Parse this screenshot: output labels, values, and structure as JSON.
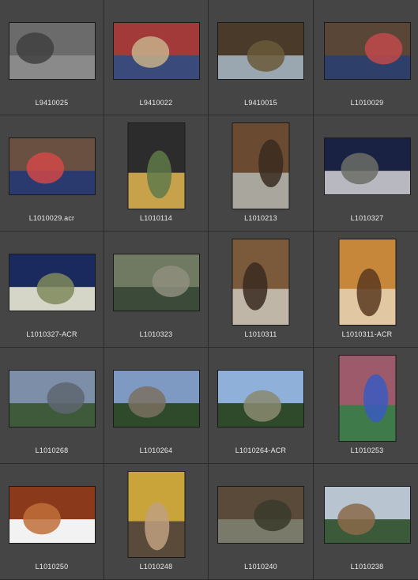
{
  "thumbnails": [
    {
      "label": "L9410025",
      "orientation": "land",
      "colors": [
        "#6b6b6b",
        "#8a8a8a",
        "#3f3f3f"
      ]
    },
    {
      "label": "L9410022",
      "orientation": "land",
      "colors": [
        "#a33a3a",
        "#3a4a7a",
        "#c7b08a"
      ]
    },
    {
      "label": "L9410015",
      "orientation": "land",
      "colors": [
        "#4a3a2a",
        "#9aa6b0",
        "#6a5a3a"
      ]
    },
    {
      "label": "L1010029",
      "orientation": "land",
      "colors": [
        "#5a4636",
        "#2e3f6a",
        "#c04a4a"
      ]
    },
    {
      "label": "L1010029.acr",
      "orientation": "land",
      "colors": [
        "#6a5040",
        "#2a3a6e",
        "#d04848"
      ]
    },
    {
      "label": "L1010114",
      "orientation": "port",
      "colors": [
        "#2c2c2c",
        "#c7a24a",
        "#5f7a4a"
      ]
    },
    {
      "label": "L1010213",
      "orientation": "port",
      "colors": [
        "#6a4a30",
        "#a9a69e",
        "#3a2a20"
      ]
    },
    {
      "label": "L1010327",
      "orientation": "land",
      "colors": [
        "#1a2244",
        "#b8b8c0",
        "#6b6f66"
      ]
    },
    {
      "label": "L1010327-ACR",
      "orientation": "land",
      "colors": [
        "#1b2a5e",
        "#d6d6c8",
        "#7f8a5a"
      ]
    },
    {
      "label": "L1010323",
      "orientation": "land",
      "colors": [
        "#707a62",
        "#3c4a3a",
        "#8e8e7e"
      ]
    },
    {
      "label": "L1010311",
      "orientation": "port",
      "colors": [
        "#7a5a3a",
        "#c0b6a8",
        "#3a2a20"
      ]
    },
    {
      "label": "L1010311-ACR",
      "orientation": "port",
      "colors": [
        "#c7873a",
        "#e2c8a2",
        "#5a3a20"
      ]
    },
    {
      "label": "L1010268",
      "orientation": "land",
      "colors": [
        "#7d8fa8",
        "#3f5a3a",
        "#5d6670"
      ]
    },
    {
      "label": "L1010264",
      "orientation": "land",
      "colors": [
        "#7f9ac2",
        "#2e4a2a",
        "#7a7060"
      ]
    },
    {
      "label": "L1010264-ACR",
      "orientation": "land",
      "colors": [
        "#8fb0d8",
        "#2e4a2a",
        "#8a8a70"
      ]
    },
    {
      "label": "L1010253",
      "orientation": "port",
      "colors": [
        "#9c5a6a",
        "#3e7a4a",
        "#3a5ac0"
      ]
    },
    {
      "label": "L1010250",
      "orientation": "land",
      "colors": [
        "#8a3a1a",
        "#f2f2f2",
        "#c0703a"
      ]
    },
    {
      "label": "L1010248",
      "orientation": "port",
      "colors": [
        "#c9a43a",
        "#5a4a3a",
        "#c0a080"
      ]
    },
    {
      "label": "L1010240",
      "orientation": "land",
      "colors": [
        "#5a4a3a",
        "#7a7a6a",
        "#3a3a2a"
      ]
    },
    {
      "label": "L1010238",
      "orientation": "land",
      "colors": [
        "#b8c4d0",
        "#3a5a3a",
        "#8a6a4a"
      ]
    }
  ]
}
